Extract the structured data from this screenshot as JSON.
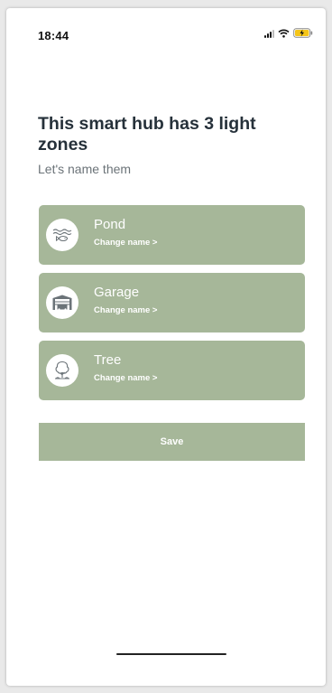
{
  "status_bar": {
    "time": "18:44"
  },
  "heading": "This smart hub has 3 light zones",
  "subheading": "Let's name them",
  "zones": [
    {
      "name": "Pond",
      "change_label": "Change name >",
      "icon": "pond-icon"
    },
    {
      "name": "Garage",
      "change_label": "Change name >",
      "icon": "garage-icon"
    },
    {
      "name": "Tree",
      "change_label": "Change name >",
      "icon": "tree-icon"
    }
  ],
  "save_label": "Save",
  "colors": {
    "accent": "#a6b799",
    "heading_text": "#26313a",
    "subheading_text": "#6b7378",
    "battery_charging": "#f5c518"
  }
}
